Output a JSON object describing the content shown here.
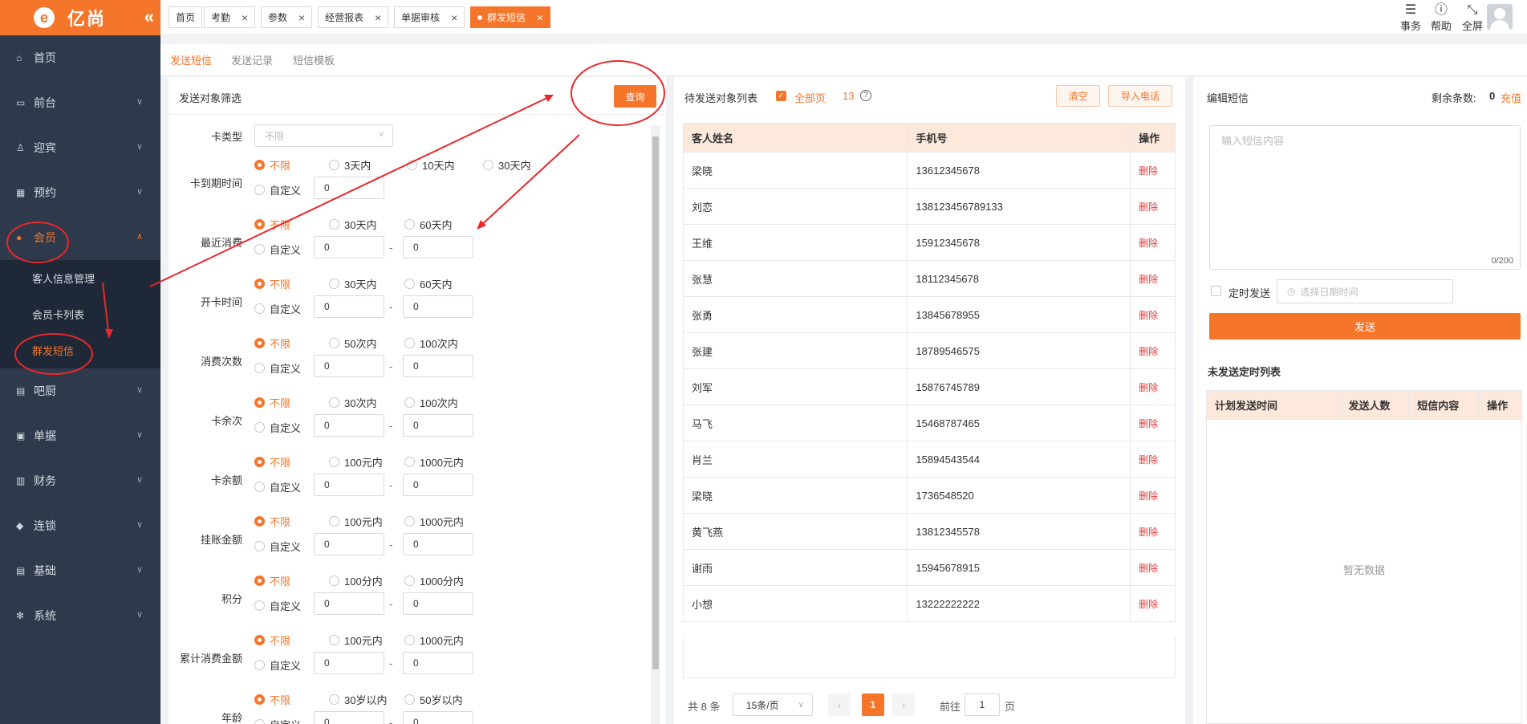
{
  "app": {
    "brand": "亿尚",
    "brand_mark": "e",
    "collapse_glyph": "«"
  },
  "sidebar": {
    "items": [
      {
        "label": "首页",
        "icon": "home-icon",
        "glyph": "⌂"
      },
      {
        "label": "前台",
        "icon": "monitor-icon",
        "glyph": "▭"
      },
      {
        "label": "迎宾",
        "icon": "reception-icon",
        "glyph": "♙"
      },
      {
        "label": "预约",
        "icon": "calendar-icon",
        "glyph": "▦"
      },
      {
        "label": "会员",
        "icon": "user-icon",
        "glyph": "●"
      },
      {
        "label": "吧厨",
        "icon": "book-icon",
        "glyph": "▤"
      },
      {
        "label": "单据",
        "icon": "receipt-icon",
        "glyph": "▣"
      },
      {
        "label": "财务",
        "icon": "finance-icon",
        "glyph": "▥"
      },
      {
        "label": "连锁",
        "icon": "chain-icon",
        "glyph": "◆"
      },
      {
        "label": "基础",
        "icon": "base-icon",
        "glyph": "▤"
      },
      {
        "label": "系统",
        "icon": "gear-icon",
        "glyph": "✻"
      }
    ],
    "member_sub": [
      "客人信息管理",
      "会员卡列表",
      "群发短信"
    ]
  },
  "tabs": [
    {
      "label": "首页",
      "closable": false
    },
    {
      "label": "考勤",
      "closable": true
    },
    {
      "label": "参数",
      "closable": true
    },
    {
      "label": "经营报表",
      "closable": true
    },
    {
      "label": "单据审核",
      "closable": true
    },
    {
      "label": "群发短信",
      "closable": true
    }
  ],
  "toolbar": {
    "tasks": "事务",
    "help": "帮助",
    "fullscreen": "全屏"
  },
  "subtabs": [
    "发送短信",
    "发送记录",
    "短信模板"
  ],
  "filter": {
    "title": "发送对象筛选",
    "query_button": "查询",
    "card_type_label": "卡类型",
    "card_type_value": "不限",
    "custom": "自定义",
    "dash": "-",
    "rows": [
      {
        "label": "卡到期时间",
        "options": [
          "不限",
          "3天内",
          "10天内",
          "30天内"
        ],
        "values": [
          "0"
        ]
      },
      {
        "label": "最近消费",
        "options": [
          "不限",
          "30天内",
          "60天内"
        ],
        "values": [
          "0",
          "0"
        ]
      },
      {
        "label": "开卡时间",
        "options": [
          "不限",
          "30天内",
          "60天内"
        ],
        "values": [
          "0",
          "0"
        ]
      },
      {
        "label": "消费次数",
        "options": [
          "不限",
          "50次内",
          "100次内"
        ],
        "values": [
          "0",
          "0"
        ]
      },
      {
        "label": "卡余次",
        "options": [
          "不限",
          "30次内",
          "100次内"
        ],
        "values": [
          "0",
          "0"
        ]
      },
      {
        "label": "卡余额",
        "options": [
          "不限",
          "100元内",
          "1000元内"
        ],
        "values": [
          "0",
          "0"
        ]
      },
      {
        "label": "挂账金额",
        "options": [
          "不限",
          "100元内",
          "1000元内"
        ],
        "values": [
          "0",
          "0"
        ]
      },
      {
        "label": "积分",
        "options": [
          "不限",
          "100分内",
          "1000分内"
        ],
        "values": [
          "0",
          "0"
        ]
      },
      {
        "label": "累计消费金额",
        "options": [
          "不限",
          "100元内",
          "1000元内"
        ],
        "values": [
          "0",
          "0"
        ]
      },
      {
        "label": "年龄",
        "options": [
          "不限",
          "30岁以内",
          "50岁以内"
        ],
        "values": [
          "0",
          "0"
        ]
      }
    ]
  },
  "recipients": {
    "title": "待发送对象列表",
    "all_pages_label": "全部页",
    "count": "13",
    "help_glyph": "?",
    "clear_button": "清空",
    "import_button": "导入电话",
    "columns": [
      "客人姓名",
      "手机号",
      "操作"
    ],
    "delete_label": "删除",
    "rows": [
      [
        "梁晓",
        "13612345678"
      ],
      [
        "刘恋",
        "138123456789133"
      ],
      [
        "王维",
        "15912345678"
      ],
      [
        "张慧",
        "18112345678"
      ],
      [
        "张勇",
        "13845678955"
      ],
      [
        "张建",
        "18789546575"
      ],
      [
        "刘军",
        "15876745789"
      ],
      [
        "马飞",
        "15468787465"
      ],
      [
        "肖兰",
        "15894543544"
      ],
      [
        "梁晓",
        "1736548520"
      ],
      [
        "黄飞燕",
        "13812345578"
      ],
      [
        "谢雨",
        "15945678915"
      ],
      [
        "小想",
        "13222222222"
      ]
    ],
    "pagination": {
      "total": "共 8 条",
      "page_size": "15条/页",
      "current": "1",
      "goto_prefix": "前往",
      "goto_value": "1",
      "goto_suffix": "页"
    }
  },
  "editor": {
    "title": "编辑短信",
    "remaining_label": "剩余条数:",
    "remaining_value": "0",
    "recharge": "充值",
    "placeholder": "输入短信内容",
    "counter": "0/200",
    "scheduled_label": "定时发送",
    "date_placeholder": "选择日期时间",
    "send_button": "发送",
    "schedule_title": "未发送定时列表",
    "schedule_columns": [
      "计划发送时间",
      "发送人数",
      "短信内容",
      "操作"
    ],
    "empty_text": "暂无数据"
  },
  "colors": {
    "accent": "#f5752a",
    "sidebar_bg": "#2e3a4b",
    "danger": "#e03a3a",
    "annotation": "#e8282b"
  }
}
